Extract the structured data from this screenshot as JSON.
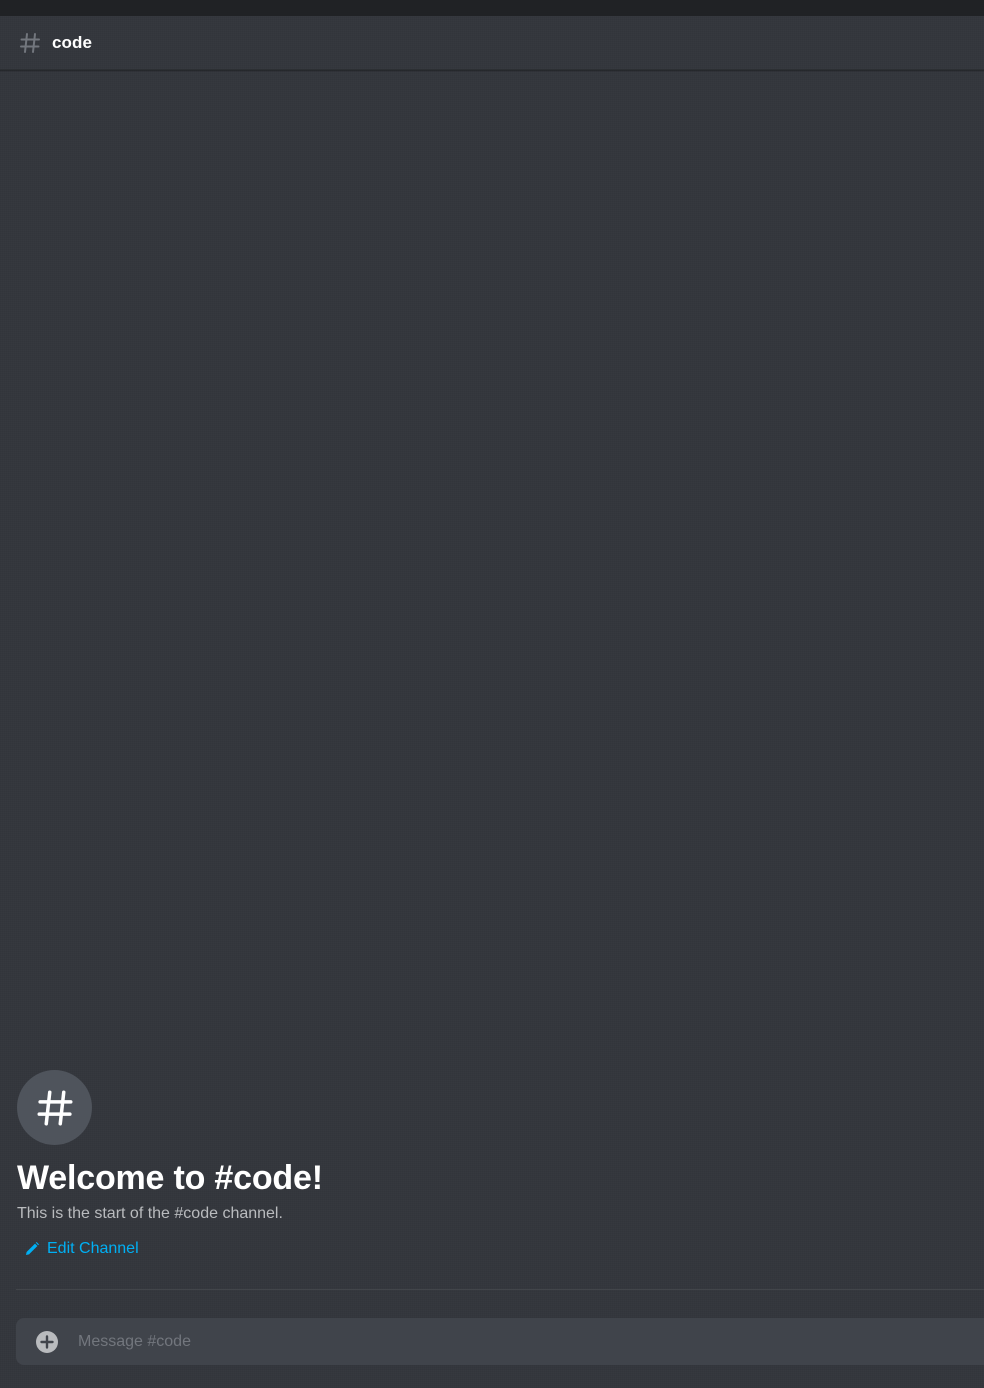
{
  "header": {
    "channel_icon": "hash-icon",
    "channel_name": "code"
  },
  "welcome": {
    "icon": "hash-icon",
    "title": "Welcome to #code!",
    "description": "This is the start of the #code channel.",
    "edit_icon": "pencil-icon",
    "edit_label": "Edit Channel"
  },
  "composer": {
    "add_icon": "add-circle-icon",
    "placeholder": "Message #code",
    "value": ""
  },
  "colors": {
    "background": "#36393f",
    "titlebar": "#202225",
    "composer": "#40444b",
    "link": "#00b0f4",
    "heading": "#ffffff",
    "muted_text": "#b9bbbe"
  }
}
